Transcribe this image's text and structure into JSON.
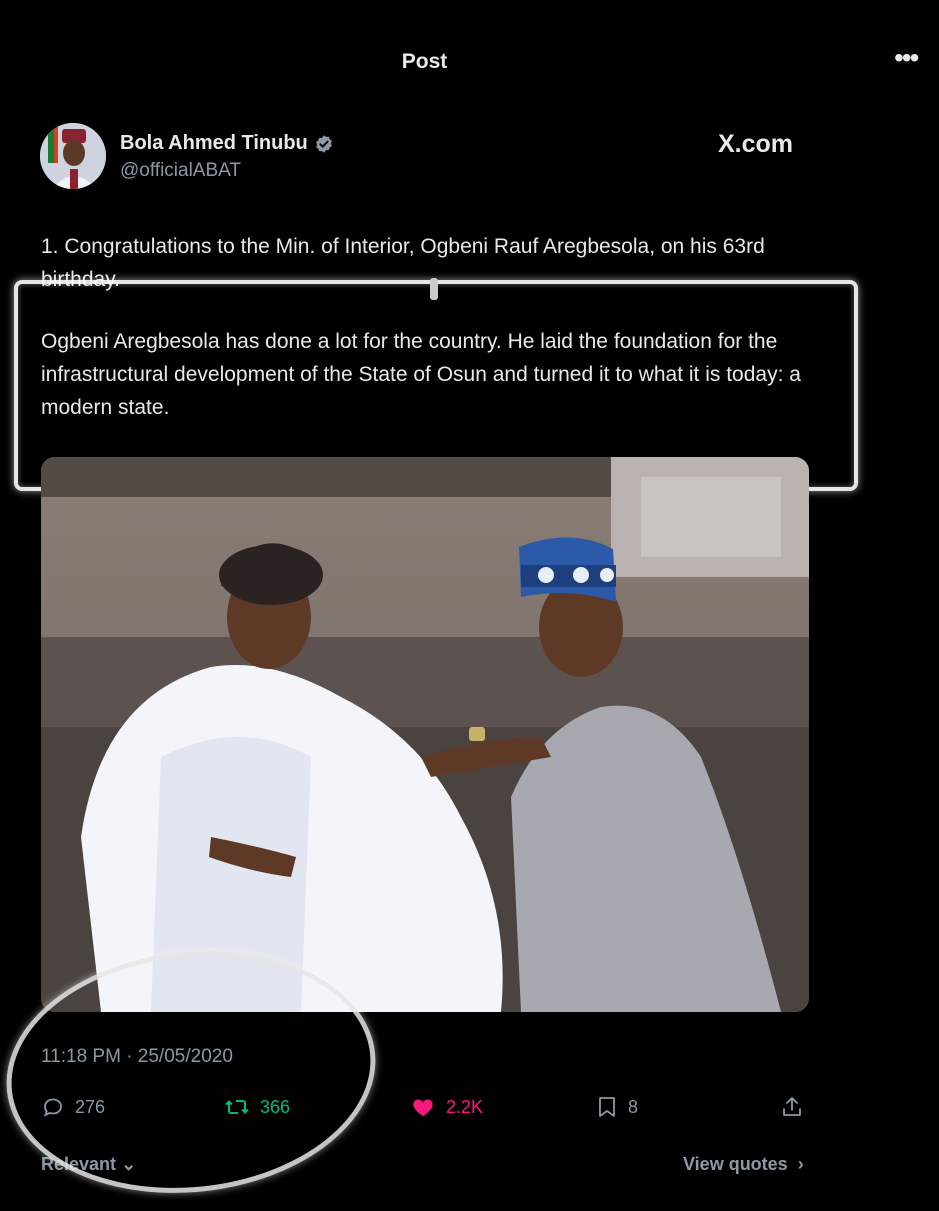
{
  "header": {
    "title": "Post",
    "more_label": "•••"
  },
  "author": {
    "name": "Bola Ahmed Tinubu",
    "handle": "@officialABAT",
    "watermark": "X.com"
  },
  "tweet": {
    "paragraph1": "1. Congratulations to the Min. of Interior, Ogbeni Rauf Aregbesola, on his 63rd birthday.",
    "paragraph2": "Ogbeni Aregbesola has done a lot for the country. He laid the foundation for the infrastructural development of the State of Osun and turned it to what it is today: a modern state.",
    "timestamp": "11:18 PM · 25/05/2020"
  },
  "actions": {
    "replies": "276",
    "reposts": "366",
    "likes": "2.2K",
    "bookmarks": "8"
  },
  "footer": {
    "sort_label": "Relevant",
    "view_quotes": "View quotes"
  },
  "colors": {
    "background": "#000000",
    "text": "#e7e9ea",
    "muted": "#8b98a5",
    "repost": "#00ba7c",
    "like": "#f91880",
    "verified": "#8b98a5"
  }
}
